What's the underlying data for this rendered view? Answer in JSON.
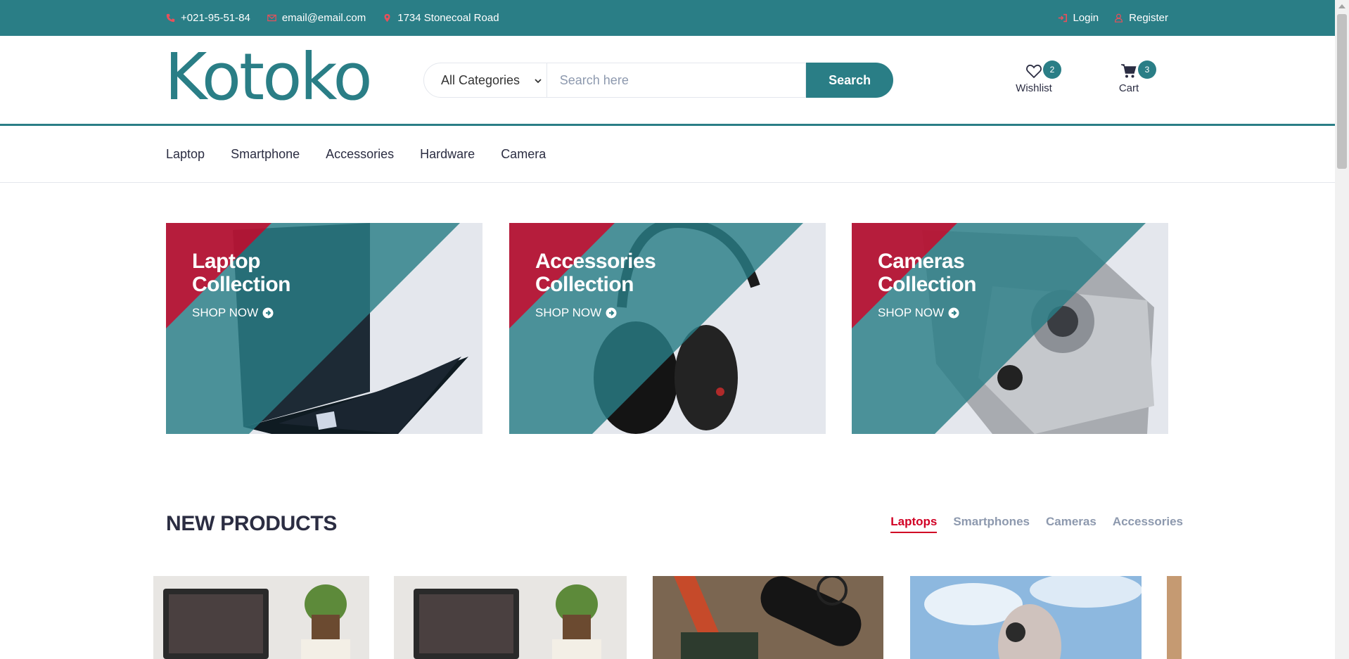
{
  "topbar": {
    "phone": "+021-95-51-84",
    "email": "email@email.com",
    "address": "1734 Stonecoal Road",
    "login": "Login",
    "register": "Register"
  },
  "header": {
    "logo": "Kotoko",
    "category_select": "All Categories",
    "search_placeholder": "Search here",
    "search_button": "Search",
    "wishlist_label": "Wishlist",
    "wishlist_count": "2",
    "cart_label": "Cart",
    "cart_count": "3"
  },
  "nav": {
    "items": [
      "Laptop",
      "Smartphone",
      "Accessories",
      "Hardware",
      "Camera"
    ]
  },
  "collections": [
    {
      "title_line1": "Laptop",
      "title_line2": "Collection",
      "cta": "SHOP NOW"
    },
    {
      "title_line1": "Accessories",
      "title_line2": "Collection",
      "cta": "SHOP NOW"
    },
    {
      "title_line1": "Cameras",
      "title_line2": "Collection",
      "cta": "SHOP NOW"
    }
  ],
  "new_products": {
    "title": "NEW PRODUCTS",
    "tabs": [
      "Laptops",
      "Smartphones",
      "Cameras",
      "Accessories"
    ],
    "active_tab": "Laptops"
  },
  "colors": {
    "primary": "#2a7e86",
    "accent": "#d10024",
    "text": "#2b2d42",
    "muted": "#8d99ae"
  }
}
